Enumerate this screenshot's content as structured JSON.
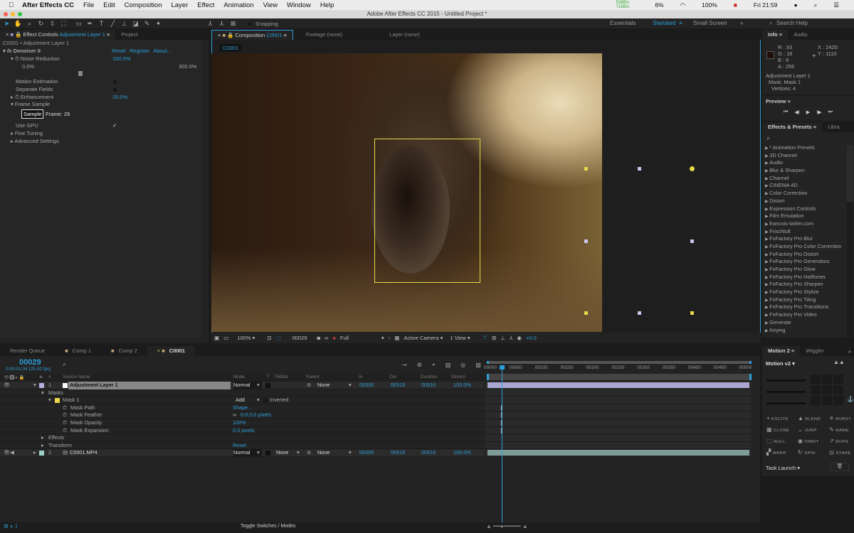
{
  "menubar": {
    "apple": "",
    "app": "After Effects CC",
    "items": [
      "File",
      "Edit",
      "Composition",
      "Layer",
      "Effect",
      "Animation",
      "View",
      "Window",
      "Help"
    ],
    "status": {
      "net_tx": "538B/s",
      "net_rx": "716B/s",
      "cpu": "6%",
      "battery": "100%",
      "clock": "Fri 21:59"
    }
  },
  "window_title": "Adobe After Effects CC 2015 - Untitled Project *",
  "toolbar": {
    "snapping": "Snapping",
    "workspaces": [
      "Essentials",
      "Standard",
      "Small Screen"
    ],
    "active_workspace": "Standard",
    "search_help": "Search Help"
  },
  "effect_controls": {
    "tab_prefix": "Effect Controls",
    "tab_layer": "Adjustment Layer 1",
    "tab_project": "Project",
    "breadcrumb": "C0001 • Adjustment Layer 1",
    "effect_name": "Denoiser II",
    "reset": "Reset",
    "register": "Register",
    "about": "About...",
    "noise_reduction_label": "Noise Reduction",
    "noise_reduction_value": "100.0%",
    "slider_min": "0.0%",
    "slider_max": "300.0%",
    "slider_fraction": 0.333,
    "motion_estimation": "Motion Estimation",
    "separate_fields": "Separate Fields",
    "enhancement_label": "Enhancement",
    "enhancement_value": "20.0%",
    "frame_sample": "Frame Sample",
    "sample_button": "Sample",
    "frame_label": "Frame: 29",
    "use_gpu": "Use GPU",
    "use_gpu_checked": true,
    "fine_tuning": "Fine Tuning",
    "advanced": "Advanced Settings"
  },
  "composition": {
    "tab_prefix": "Composition",
    "tab_name": "C0001",
    "footage_tab": "Footage (none)",
    "layer_tab": "Layer (none)",
    "comp_label": "C0001",
    "zoom": "100%",
    "timecode": "00029",
    "resolution": "Full",
    "camera": "Active Camera",
    "views": "1 View",
    "exposure": "+0.0",
    "mask_color": "#e8d84a"
  },
  "info": {
    "tab": "Info",
    "audio_tab": "Audio",
    "r": "R : 33",
    "g": "G : 16",
    "b": "B : 6",
    "a": "A : 255",
    "x": "X : 2420",
    "y": "Y : 1110",
    "swatch": "#21100a",
    "layer": "Adjustment Layer 1",
    "mask": "Mask: Mask 1",
    "vertices": "Vertices: 4"
  },
  "preview": {
    "title": "Preview",
    "controls": [
      "⏮",
      "◀I",
      "▶",
      "I▶",
      "⏭"
    ]
  },
  "effects_presets": {
    "tab": "Effects & Presets",
    "libra_tab": "Libra",
    "items": [
      "* Animation Presets",
      "3D Channel",
      "Audio",
      "Blur & Sharpen",
      "Channel",
      "CINEMA 4D",
      "Color Correction",
      "Distort",
      "Expression Controls",
      "Film Emulation",
      "francois-tarlier.com",
      "Frischluft",
      "FxFactory Pro Blur",
      "FxFactory Pro Color Correction",
      "FxFactory Pro Distort",
      "FxFactory Pro Generators",
      "FxFactory Pro Glow",
      "FxFactory Pro Halftones",
      "FxFactory Pro Sharpen",
      "FxFactory Pro Stylize",
      "FxFactory Pro Tiling",
      "FxFactory Pro Transitions",
      "FxFactory Pro Video",
      "Generate",
      "Keying"
    ]
  },
  "timeline": {
    "tabs": [
      "Render Queue",
      "Comp 1",
      "Comp 2",
      "C0001"
    ],
    "timecode": "00029",
    "timecode_sub": "0:00:01:04 (25.00 fps)",
    "columns": {
      "num": "#",
      "source": "Source Name",
      "mode": "Mode",
      "t": "T",
      "trkmat": "TrkMat",
      "parent": "Parent",
      "in": "In",
      "out": "Out",
      "duration": "Duration",
      "stretch": "Stretch"
    },
    "ruler": [
      "00000",
      "00050",
      "00100",
      "00150",
      "00200",
      "00250",
      "00300",
      "00350",
      "00400",
      "00450",
      "00500"
    ],
    "playhead_frame": 29,
    "total_frames": 516,
    "layers": [
      {
        "num": "1",
        "name": "Adjustment Layer 1",
        "label_color": "#b3b0dd",
        "mode": "Normal",
        "parent": "None",
        "in": "00000",
        "out": "00515",
        "duration": "00516",
        "stretch": "100.0%"
      },
      {
        "num": "2",
        "name": "C0001.MP4",
        "label_color": "#9ad0c8",
        "mode": "Normal",
        "trkmat": "None",
        "parent": "None",
        "in": "00000",
        "out": "00515",
        "duration": "00516",
        "stretch": "100.0%"
      }
    ],
    "masks_label": "Masks",
    "mask1": "Mask 1",
    "mask_mode": "Add",
    "inverted": "Inverted",
    "props": [
      {
        "name": "Mask Path",
        "value": "Shape..."
      },
      {
        "name": "Mask Feather",
        "value": "0.0,0.0 pixels"
      },
      {
        "name": "Mask Opacity",
        "value": "100%"
      },
      {
        "name": "Mask Expansion",
        "value": "0.0 pixels"
      }
    ],
    "effects": "Effects",
    "transform": "Transform",
    "reset": "Reset",
    "toggle": "Toggle Switches / Modes"
  },
  "motion2": {
    "tab": "Motion 2",
    "wiggler_tab": "Wiggler",
    "preset": "Motion v2",
    "buttons": [
      "EXCITE",
      "BLEND",
      "BURST",
      "CLONE",
      "JUMP",
      "NAME",
      "NULL",
      "ORBIT",
      "ROPE",
      "WARP",
      "SPIN",
      "STARE"
    ],
    "task": "Task Launch"
  }
}
